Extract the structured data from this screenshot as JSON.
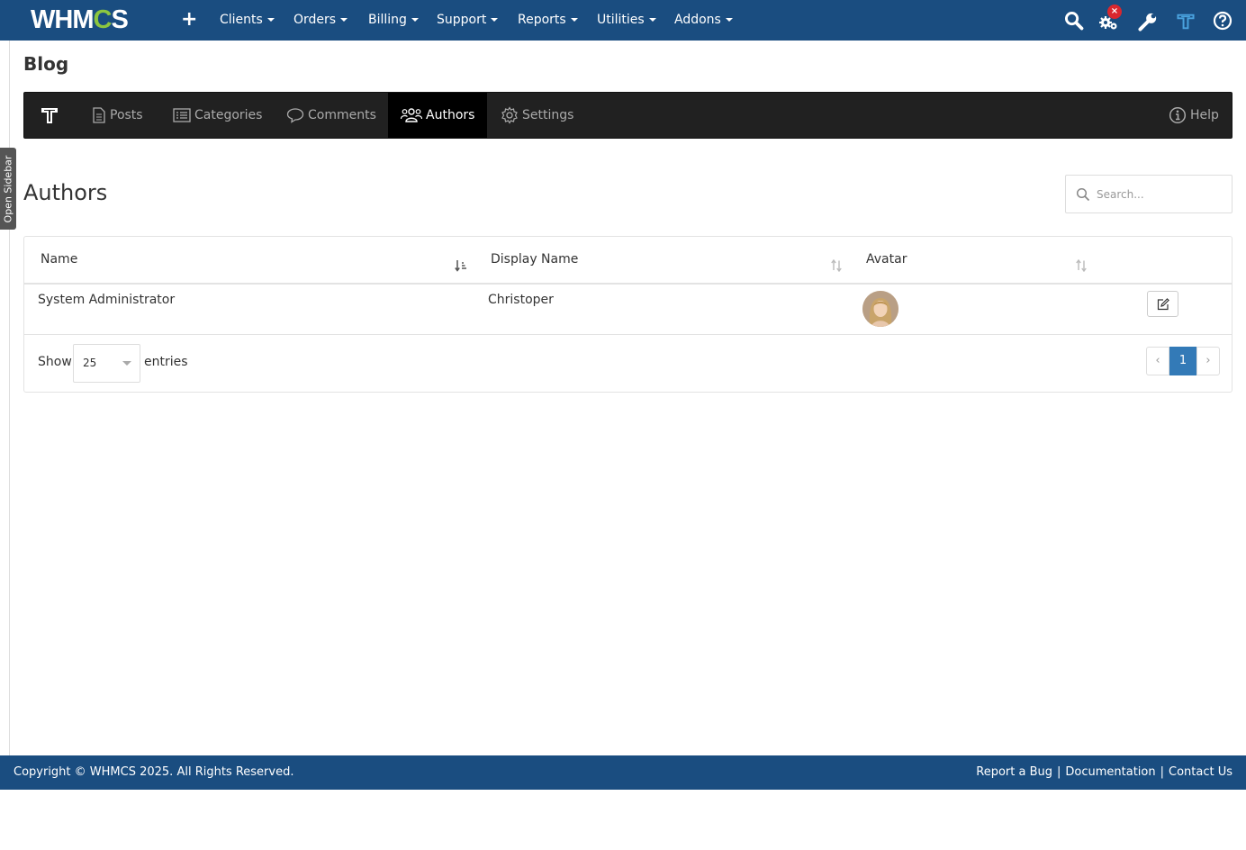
{
  "topbar": {
    "logo_prefix": "WHM",
    "logo_gear": "C",
    "logo_suffix": "S",
    "plus": "+",
    "nav": [
      "Clients",
      "Orders",
      "Billing",
      "Support",
      "Reports",
      "Utilities",
      "Addons"
    ],
    "badge": "×"
  },
  "sidebar_tab": "Open Sidebar",
  "page_title": "Blog",
  "module_nav": {
    "posts": "Posts",
    "categories": "Categories",
    "comments": "Comments",
    "authors": "Authors",
    "settings": "Settings",
    "help": "Help"
  },
  "section_title": "Authors",
  "search": {
    "placeholder": "Search..."
  },
  "table": {
    "headers": [
      "Name",
      "Display Name",
      "Avatar"
    ],
    "rows": [
      {
        "name": "System Administrator",
        "display_name": "Christoper"
      }
    ]
  },
  "length": {
    "show": "Show",
    "value": "25",
    "entries": "entries"
  },
  "pagination": {
    "prev": "‹",
    "current": "1",
    "next": "›"
  },
  "footer": {
    "copyright": "Copyright © WHMCS 2025. All Rights Reserved.",
    "report_bug": "Report a Bug",
    "documentation": "Documentation",
    "contact": "Contact Us",
    "separator": "|"
  },
  "colors": {
    "topbar": "#1a4d80",
    "modbar": "#212121",
    "accent": "#337ab7",
    "logo_gear": "#8dc63f"
  }
}
